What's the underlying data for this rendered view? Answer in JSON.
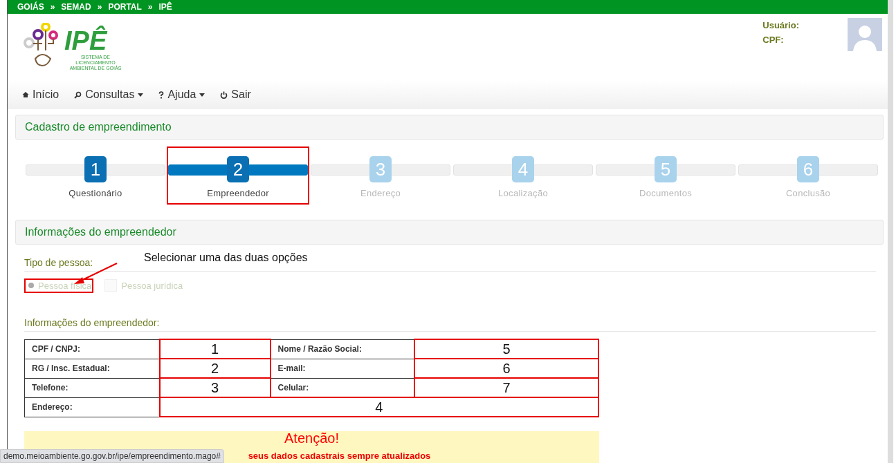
{
  "breadcrumb": [
    "GOIÁS",
    "»",
    "SEMAD",
    "»",
    "PORTAL",
    "»",
    "IPÊ"
  ],
  "logo": {
    "title": "IPÊ",
    "subtitle": "SISTEMA DE LICENCIAMENTO AMBIENTAL DE GOIÁS"
  },
  "user": {
    "labels": [
      "Usuário:",
      "CPF:"
    ]
  },
  "nav": [
    {
      "label": "Início",
      "dropdown": false
    },
    {
      "label": "Consultas",
      "dropdown": true
    },
    {
      "label": "Ajuda",
      "dropdown": true
    },
    {
      "label": "Sair",
      "dropdown": false
    }
  ],
  "page_title": "Cadastro de empreendimento",
  "steps": [
    {
      "number": "1",
      "label": "Questionário",
      "selected": false,
      "highlighted": false
    },
    {
      "number": "2",
      "label": "Empreendedor",
      "selected": true,
      "highlighted": true
    },
    {
      "number": "3",
      "label": "Endereço",
      "selected": false,
      "highlighted": false
    },
    {
      "number": "4",
      "label": "Localização",
      "selected": false,
      "highlighted": false
    },
    {
      "number": "5",
      "label": "Documentos",
      "selected": false,
      "highlighted": false
    },
    {
      "number": "6",
      "label": "Conclusão",
      "selected": false,
      "highlighted": false
    }
  ],
  "section_title": "Informações do empreendedor",
  "person_type": {
    "label": "Tipo de pessoa:",
    "callout": "Selecionar uma das duas opções",
    "disabled": true,
    "options": [
      {
        "kind": "radio",
        "label": "Pessoa física",
        "selected": true,
        "highlighted": true
      },
      {
        "kind": "checkbox",
        "label": "Pessoa jurídica",
        "selected": false,
        "highlighted": false
      }
    ]
  },
  "info_title": "Informações do empreendedor:",
  "table": {
    "rows": [
      [
        {
          "label": "CPF / CNPJ:"
        },
        {
          "value": "1",
          "highlighted": true
        },
        {
          "label": "Nome / Razão Social:"
        },
        {
          "value": "5",
          "highlighted": true
        }
      ],
      [
        {
          "label": "RG / Insc. Estadual:"
        },
        {
          "value": "2",
          "highlighted": true
        },
        {
          "label": "E-mail:"
        },
        {
          "value": "6",
          "highlighted": true
        }
      ],
      [
        {
          "label": "Telefone:"
        },
        {
          "value": "3",
          "highlighted": true
        },
        {
          "label": "Celular:"
        },
        {
          "value": "7",
          "highlighted": true
        }
      ]
    ],
    "address": {
      "label": "Endereço:",
      "value": "4",
      "highlighted": true
    }
  },
  "alert": {
    "title": "Atenção!",
    "text": "seus dados cadastrais sempre atualizados"
  },
  "status_url": "demo.meioambiente.go.gov.br/ipe/empreendimento.mago#"
}
